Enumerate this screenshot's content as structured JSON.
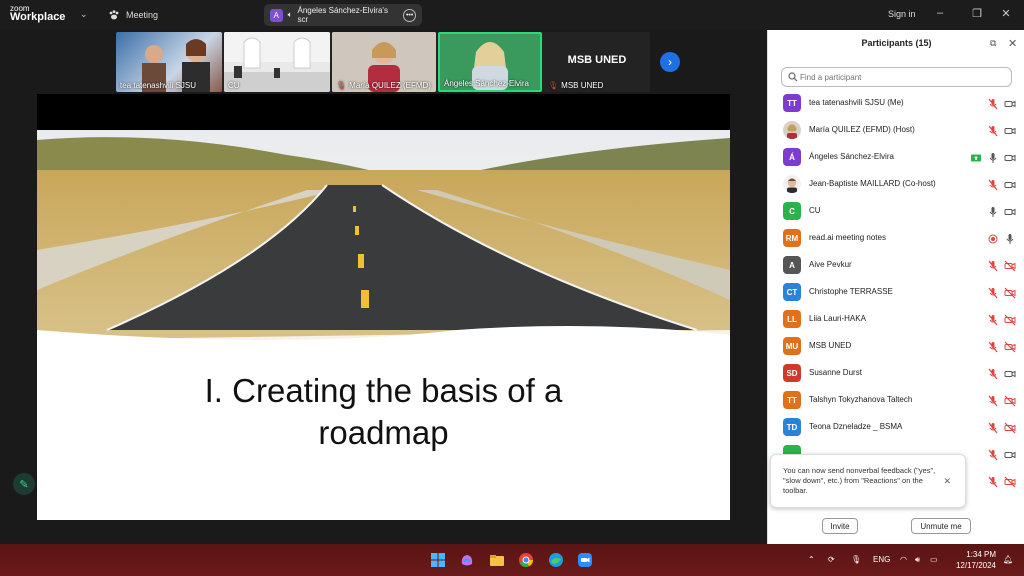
{
  "app": {
    "logo_line1": "zoom",
    "logo_line2": "Workplace",
    "meeting_label": "Meeting",
    "share_pill_initial": "A",
    "share_pill_text": "Ángeles Sánchez-Elvira's scr",
    "signin_label": "Sign in"
  },
  "video_strip": {
    "tiles": [
      {
        "name": "tea tatenashvili SJSU",
        "muted": false
      },
      {
        "name": "CU",
        "muted": false
      },
      {
        "name": "María QUILEZ (EFMD)",
        "muted": true
      },
      {
        "name": "Ángeles Sánchez-Elvira",
        "muted": false,
        "active": true
      },
      {
        "name": "MSB UNED",
        "muted": true,
        "big_label": "MSB UNED"
      }
    ]
  },
  "slide": {
    "title_line1": "I. Creating the basis of a",
    "title_line2": "roadmap"
  },
  "participants": {
    "title": "Participants (15)",
    "search_placeholder": "Find a participant",
    "items": [
      {
        "initials": "TT",
        "name": "tea tatenashvili SJSU (Me)",
        "color": "#7e3bd0",
        "mic": "muted",
        "video": "on"
      },
      {
        "initials": "",
        "name": "María QUILEZ (EFMD) (Host)",
        "color": "photo-woman",
        "mic": "muted",
        "video": "on"
      },
      {
        "initials": "Á",
        "name": "Ángeles Sánchez-Elvira",
        "color": "#7e3bd0",
        "mic": "on",
        "video": "on",
        "sharing": true
      },
      {
        "initials": "",
        "name": "Jean-Baptiste MAILLARD (Co-host)",
        "color": "photo-man",
        "mic": "muted",
        "video": "on"
      },
      {
        "initials": "C",
        "name": "CU",
        "color": "#2bb24c",
        "mic": "on",
        "video": "on"
      },
      {
        "initials": "RM",
        "name": "read.ai meeting notes",
        "color": "#e0701a",
        "mic": "on",
        "video": "none",
        "recording": true
      },
      {
        "initials": "A",
        "name": "Aive Pevkur",
        "color": "#555555",
        "mic": "muted",
        "video": "off"
      },
      {
        "initials": "CT",
        "name": "Christophe TERRASSE",
        "color": "#2a83d6",
        "mic": "muted",
        "video": "off"
      },
      {
        "initials": "LL",
        "name": "Liia Lauri-HAKA",
        "color": "#e0701a",
        "mic": "muted",
        "video": "off"
      },
      {
        "initials": "MU",
        "name": "MSB UNED",
        "color": "#e0701a",
        "mic": "muted",
        "video": "off"
      },
      {
        "initials": "SD",
        "name": "Susanne Durst",
        "color": "#d0392b",
        "mic": "muted",
        "video": "on"
      },
      {
        "initials": "TT",
        "name": "Talshyn Tokyzhanova Taltech",
        "color": "#e0701a",
        "mic": "muted",
        "video": "off"
      },
      {
        "initials": "TD",
        "name": "Teona Dzneladze _ BSMA",
        "color": "#2a83d6",
        "mic": "muted",
        "video": "off"
      },
      {
        "initials": "",
        "name": "",
        "color": "#2bb24c",
        "mic": "muted",
        "video": "on"
      },
      {
        "initials": "",
        "name": "",
        "color": "#2bb24c",
        "mic": "muted",
        "video": "off"
      }
    ],
    "toast_text": "You can now send nonverbal feedback (\"yes\", \"slow down\", etc.) from \"Reactions\" on the toolbar.",
    "invite_label": "Invite",
    "unmute_label": "Unmute me"
  },
  "taskbar": {
    "lang": "ENG",
    "time": "1:34 PM",
    "date": "12/17/2024"
  },
  "colors": {
    "accent_blue": "#1f6fe5",
    "mute_red": "#e04444",
    "active_green": "#2bd97a"
  }
}
